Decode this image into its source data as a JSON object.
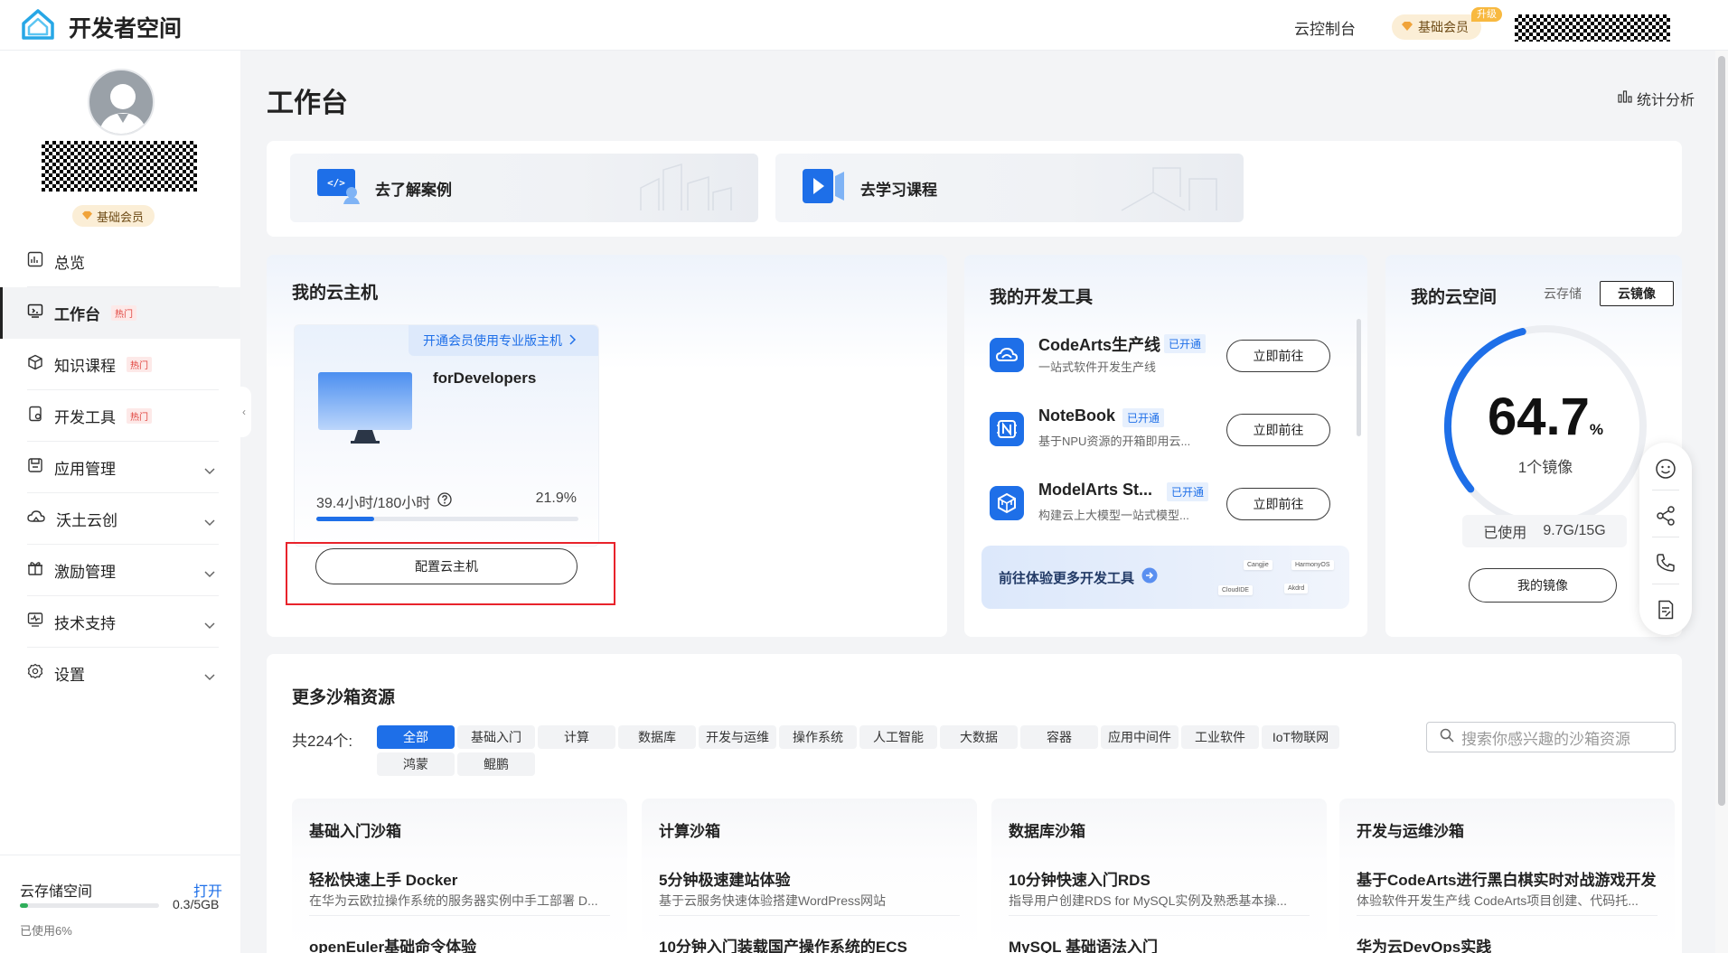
{
  "header": {
    "brand": "开发者空间",
    "console": "云控制台",
    "member": "基础会员",
    "upgrade": "升级"
  },
  "sidebar": {
    "member_badge": "基础会员",
    "items": [
      {
        "label": "总览",
        "icon": "overview-icon"
      },
      {
        "label": "工作台",
        "icon": "workbench-icon",
        "hot": "热门",
        "active": true
      },
      {
        "label": "知识课程",
        "icon": "course-cube-icon",
        "hot": "热门"
      },
      {
        "label": "开发工具",
        "icon": "dev-tools-icon",
        "hot": "热门"
      },
      {
        "label": "应用管理",
        "icon": "app-manage-icon",
        "expandable": true
      },
      {
        "label": "沃土云创",
        "icon": "cloud-create-icon",
        "expandable": true
      },
      {
        "label": "激励管理",
        "icon": "gift-icon",
        "expandable": true
      },
      {
        "label": "技术支持",
        "icon": "support-icon",
        "expandable": true
      },
      {
        "label": "设置",
        "icon": "gear-icon",
        "expandable": true
      }
    ],
    "storage": {
      "title": "云存储空间",
      "open": "打开",
      "size": "0.3/5GB",
      "used": "已使用6%",
      "used_fraction": 0.06
    }
  },
  "main": {
    "title": "工作台",
    "stats": "统计分析",
    "shortcuts": [
      {
        "label": "去了解案例",
        "icon": "code-case-icon"
      },
      {
        "label": "去学习课程",
        "icon": "video-play-icon"
      }
    ],
    "cloud_host": {
      "title": "我的云主机",
      "banner": "开通会员使用专业版主机",
      "name": "forDevelopers",
      "hours": "39.4小时/180小时",
      "percent": "21.9%",
      "usage_fraction": 0.219,
      "configure": "配置云主机"
    },
    "dev_tools": {
      "title": "我的开发工具",
      "items": [
        {
          "name": "CodeArts生产线",
          "badge": "已开通",
          "desc": "一站式软件开发生产线",
          "action": "立即前往"
        },
        {
          "name": "NoteBook",
          "badge": "已开通",
          "desc": "基于NPU资源的开箱即用云...",
          "action": "立即前往"
        },
        {
          "name": "ModelArts St...",
          "badge": "已开通",
          "desc": "构建云上大模型一站式模型...",
          "action": "立即前往"
        }
      ],
      "more": "前往体验更多开发工具",
      "logos": [
        "Cangjie",
        "HarmonyOS",
        "CloudIDE",
        "Akdrd"
      ]
    },
    "cloud_space": {
      "title": "我的云空间",
      "tabs": [
        "云存储",
        "云镜像"
      ],
      "active_tab": "云镜像",
      "value": "64.7",
      "unit": "%",
      "fraction": 0.647,
      "count": "1个镜像",
      "used_label": "已使用",
      "used_value": "9.7G/15G",
      "button": "我的镜像"
    },
    "sandbox": {
      "title": "更多沙箱资源",
      "total": "共224个:",
      "chips": [
        "全部",
        "基础入门",
        "计算",
        "数据库",
        "开发与运维",
        "操作系统",
        "人工智能",
        "大数据",
        "容器",
        "应用中间件",
        "工业软件",
        "IoT物联网",
        "鸿蒙",
        "鲲鹏"
      ],
      "search_placeholder": "搜索你感兴趣的沙箱资源",
      "columns": [
        {
          "title": "基础入门沙箱",
          "items": [
            {
              "title": "轻松快速上手 Docker",
              "desc": "在华为云欧拉操作系统的服务器实例中手工部署 D..."
            },
            {
              "title": "openEuler基础命令体验",
              "desc": ""
            }
          ]
        },
        {
          "title": "计算沙箱",
          "items": [
            {
              "title": "5分钟极速建站体验",
              "desc": "基于云服务快速体验搭建WordPress网站"
            },
            {
              "title": "10分钟入门装载国产操作系统的ECS",
              "desc": ""
            }
          ]
        },
        {
          "title": "数据库沙箱",
          "items": [
            {
              "title": "10分钟快速入门RDS",
              "desc": "指导用户创建RDS for MySQL实例及熟悉基本操..."
            },
            {
              "title": "MySQL 基础语法入门",
              "desc": ""
            }
          ]
        },
        {
          "title": "开发与运维沙箱",
          "items": [
            {
              "title": "基于CodeArts进行黑白棋实时对战游戏开发",
              "desc": "体验软件开发生产线 CodeArts项目创建、代码托..."
            },
            {
              "title": "华为云DevOps实践",
              "desc": ""
            }
          ]
        }
      ]
    },
    "floating_tools": [
      "smile-icon",
      "share-icon",
      "phone-icon",
      "feedback-icon"
    ]
  },
  "colors": {
    "accent": "#1e6fe8",
    "hot": "#e0403a",
    "highlight_box": "#e8232b",
    "member_bg": "#fbeed6",
    "upgrade": "#f8b940"
  }
}
